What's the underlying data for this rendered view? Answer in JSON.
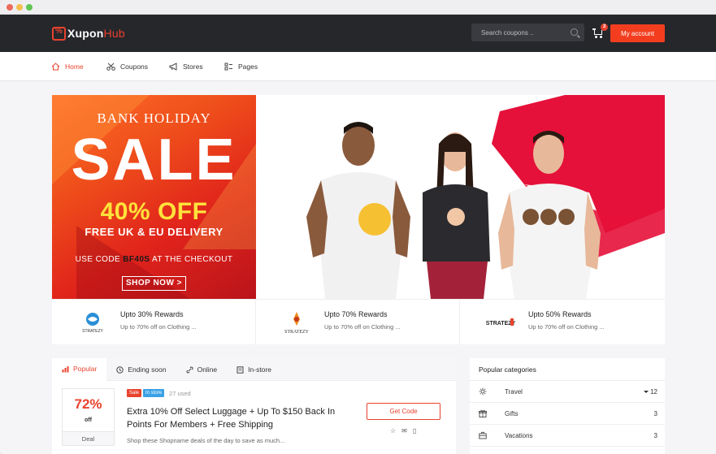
{
  "brand": {
    "name_prefix": "Xupon",
    "name_suffix": "Hub",
    "accent": "#f23e1f",
    "dark": "#26272b"
  },
  "header": {
    "search_placeholder": "Search coupons ..",
    "cart_count": "3",
    "account_label": "My account"
  },
  "nav": {
    "items": [
      {
        "label": "Home",
        "icon": "home-icon",
        "active": true
      },
      {
        "label": "Coupons",
        "icon": "scissors-icon",
        "active": false
      },
      {
        "label": "Stores",
        "icon": "megaphone-icon",
        "active": false
      },
      {
        "label": "Pages",
        "icon": "pages-icon",
        "active": false
      }
    ]
  },
  "banner": {
    "headline_top": "BANK HOLIDAY",
    "headline_big": "SALE",
    "offer": "40% OFF",
    "delivery": "FREE UK & EU DELIVERY",
    "code_prefix": "USE CODE ",
    "code": "BF40S",
    "code_suffix": " AT THE CHECKOUT",
    "cta": "SHOP NOW >"
  },
  "rewards": [
    {
      "logo_text": "STRATEZY",
      "title": "Upto 30% Rewards",
      "desc": "Up to 70% off on Clothing ..."
    },
    {
      "logo_text": "STRATEZY",
      "title": "Upto 70% Rewards",
      "desc": "Up to 70% off on Clothing ..."
    },
    {
      "logo_text": "STRATEZY",
      "title": "Upto 50% Rewards",
      "desc": "Up to 70% off on Clothing ..."
    }
  ],
  "tabs": [
    {
      "label": "Popular",
      "icon": "bar-chart-icon",
      "active": true
    },
    {
      "label": "Ending soon",
      "icon": "clock-icon",
      "active": false
    },
    {
      "label": "Online",
      "icon": "link-icon",
      "active": false
    },
    {
      "label": "In-store",
      "icon": "receipt-icon",
      "active": false
    }
  ],
  "deal": {
    "percent": "72%",
    "off": "off",
    "type": "Deal",
    "badge_sale": "Sale",
    "badge_store": "In store",
    "used": "27 used",
    "title": "Extra 10% Off Select Luggage + Up To $150 Back In Points For Members + Free Shipping",
    "desc": "Shop these Shopname deals of the day to save as much...",
    "button": "Get Code",
    "actions": [
      "☆",
      "✉",
      "▯"
    ]
  },
  "categories": {
    "title": "Popular categories",
    "items": [
      {
        "name": "Travel",
        "count": "12",
        "icon": "sun-icon",
        "expandable": true
      },
      {
        "name": "Gifts",
        "count": "3",
        "icon": "gift-icon",
        "expandable": false
      },
      {
        "name": "Vacations",
        "count": "3",
        "icon": "briefcase-icon",
        "expandable": false
      }
    ]
  }
}
